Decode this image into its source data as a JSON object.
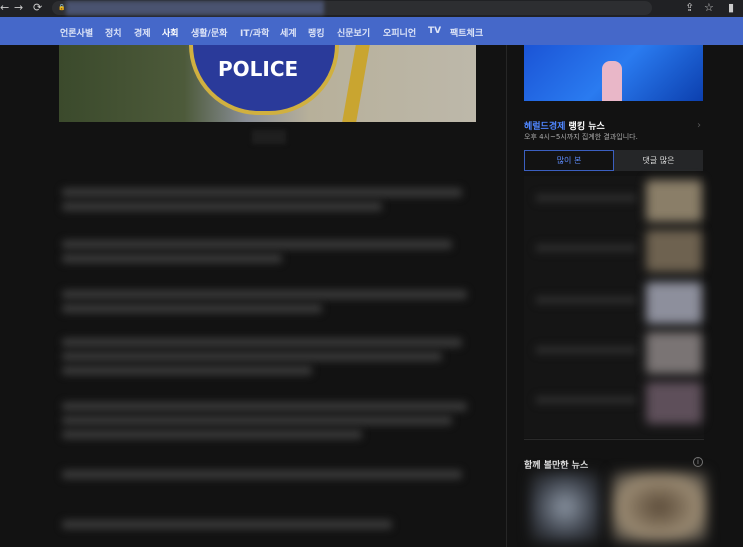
{
  "browser": {
    "back_icon": "←",
    "forward_icon": "→",
    "reload_icon": "⟳",
    "lock_icon": "🔒",
    "share_icon": "⇪",
    "star_icon": "☆",
    "panel_icon": "▮"
  },
  "nav": {
    "items": [
      "언론사별",
      "정치",
      "경제",
      "사회",
      "생활/문화",
      "IT/과학",
      "세계",
      "랭킹",
      "신문보기",
      "오피니언",
      "TV",
      "팩트체크"
    ],
    "active": "사회"
  },
  "hero": {
    "badge_text": "POLICE"
  },
  "ranking": {
    "brand": "헤럴드경제",
    "title_rest": " 랭킹 뉴스",
    "subtitle": "오후 4시~5시까지 집계한 결과입니다.",
    "tabs": [
      "많이 본",
      "댓글 많은"
    ],
    "chevron": "›"
  },
  "related": {
    "title": "함께 볼만한 뉴스",
    "info_icon": "i"
  },
  "colors": {
    "nav": "#4568c9",
    "accent": "#4f86ff",
    "bg": "#121212"
  }
}
